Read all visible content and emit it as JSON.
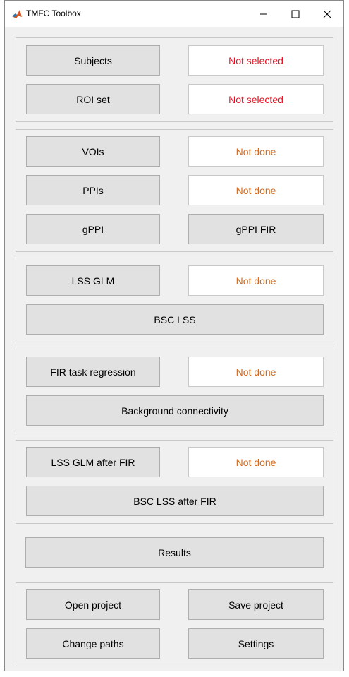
{
  "window": {
    "title": "TMFC Toolbox",
    "controls": {
      "minimize": "minimize",
      "maximize": "maximize",
      "close": "close"
    }
  },
  "colors": {
    "not_selected": "#e81123",
    "not_done": "#d2691e"
  },
  "selection": {
    "subjects_label": "Subjects",
    "subjects_status": "Not selected",
    "roi_label": "ROI set",
    "roi_status": "Not selected"
  },
  "ppi": {
    "vois_label": "VOIs",
    "vois_status": "Not done",
    "ppis_label": "PPIs",
    "ppis_status": "Not done",
    "gppi_label": "gPPI",
    "gppi_fir_label": "gPPI FIR"
  },
  "lss": {
    "lss_glm_label": "LSS GLM",
    "lss_glm_status": "Not done",
    "bsc_lss_label": "BSC LSS"
  },
  "fir": {
    "fir_label": "FIR task regression",
    "fir_status": "Not done",
    "bgc_label": "Background connectivity"
  },
  "lss_fir": {
    "lss_glm_fir_label": "LSS GLM after FIR",
    "lss_glm_fir_status": "Not done",
    "bsc_lss_fir_label": "BSC LSS after FIR"
  },
  "results_label": "Results",
  "project": {
    "open_label": "Open project",
    "save_label": "Save project",
    "change_paths_label": "Change paths",
    "settings_label": "Settings"
  }
}
